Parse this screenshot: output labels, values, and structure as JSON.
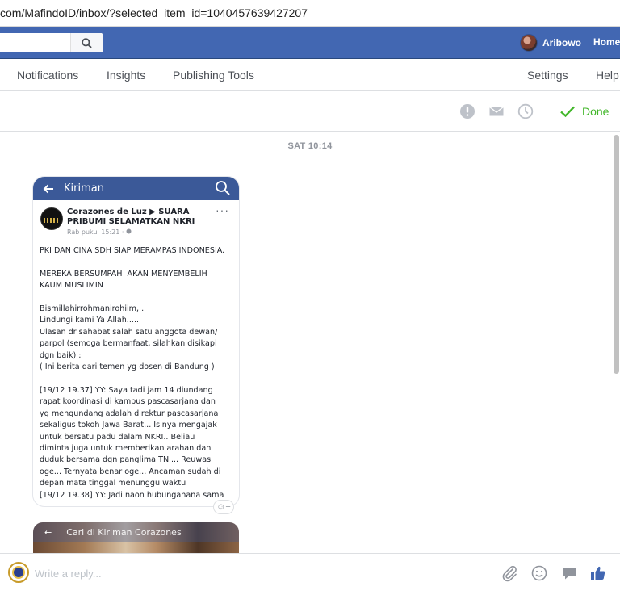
{
  "browser": {
    "url_main": "com/MafindoID/inbox/?selected_item_id=1040457639427207"
  },
  "topbar": {
    "user_name": "Aribowo",
    "home_label": "Home"
  },
  "page_tabs": {
    "notifications": "Notifications",
    "insights": "Insights",
    "publishing_tools": "Publishing Tools",
    "settings": "Settings",
    "help": "Help"
  },
  "toolbar": {
    "done_label": "Done"
  },
  "conversation": {
    "timestamp": "SAT 10:14",
    "attachment": {
      "header_title": "Kiriman",
      "author": "Corazones de Luz ▶ SUARA PRIBUMI SELAMATKAN NKRI",
      "meta": "Rab pukul 15:21 · ",
      "body": "PKI DAN CINA SDH SIAP MERAMPAS INDONESIA.\n\nMEREKA BERSUMPAH  AKAN MENYEMBELIH\nKAUM MUSLIMIN\n\nBismillahirrohmanirohiim,..\nLindungi kami Ya Allah.....\nUlasan dr sahabat salah satu anggota dewan/\nparpol (semoga bermanfaat, silahkan disikapi\ndgn baik) :\n( Ini berita dari temen yg dosen di Bandung )\n\n[19/12 19.37] YY: Saya tadi jam 14 diundang\nrapat koordinasi di kampus pascasarjana dan\nyg mengundang adalah direktur pascasarjana\nsekaligus tokoh Jawa Barat... Isinya mengajak\nuntuk bersatu padu dalam NKRI.. Beliau\ndiminta juga untuk memberikan arahan dan\nduduk bersama dgn panglima TNI... Reuwas\noge... Ternyata benar oge... Ancaman sudah di\ndepan mata tinggal menunggu waktu\n[19/12 19.38] YY: Jadi naon hubunganana sama"
    },
    "attachment2": {
      "search_text": "Cari di Kiriman Corazones"
    }
  },
  "composer": {
    "placeholder": "Write a reply..."
  },
  "colors": {
    "fb_blue": "#4267b2",
    "done_green": "#42b72a",
    "like_blue": "#4267b2"
  },
  "icons": [
    "search-icon",
    "report-icon",
    "mail-icon",
    "clock-icon",
    "checkmark-icon",
    "back-arrow-icon",
    "more-icon",
    "emoji-react-icon",
    "attachment-icon",
    "emoji-icon",
    "sticker-icon",
    "thumbs-up-icon"
  ]
}
